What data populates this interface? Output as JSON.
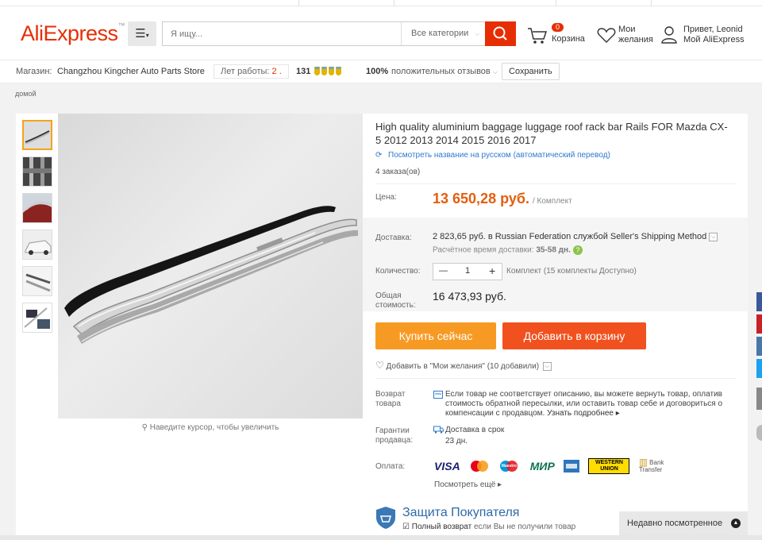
{
  "header": {
    "logo": "AliExpress",
    "search_placeholder": "Я ищу...",
    "category": "Все категории",
    "cart_count": "0",
    "cart_label": "Корзина",
    "wish_label": "Мои желания",
    "greeting": "Привет, Leonid",
    "account_label": "Мой AliExpress"
  },
  "store": {
    "label": "Магазин:",
    "name": "Changzhou Kingcher Auto Parts Store",
    "years_label": "Лет работы:",
    "years_value": "2",
    "rating": "131",
    "feedback_pct": "100%",
    "feedback_label": "положительных отзывов",
    "save_label": "Сохранить"
  },
  "breadcrumb": "домой",
  "gallery": {
    "zoom_hint": "Наведите курсор, чтобы увеличить",
    "thumb_count": 6
  },
  "product": {
    "title": "High quality aluminium baggage luggage roof rack bar Rails FOR Mazda CX-5 2012 2013 2014 2015 2016 2017",
    "translate_link": "Посмотреть название на русском (автоматический перевод)",
    "orders": "4 заказа(ов)",
    "price_label": "Цена:",
    "price": "13 650,28 руб.",
    "price_unit": "/ Комплект",
    "shipping_label": "Доставка:",
    "shipping_text": "2 823,65 руб. в Russian Federation службой Seller's Shipping Method",
    "delivery_est_label": "Расчётное время доставки:",
    "delivery_est_value": "35-58 дн.",
    "qty_label": "Количество:",
    "qty_value": "1",
    "qty_available": "Комплект (15 комплекты Доступно)",
    "total_label_1": "Общая",
    "total_label_2": "стоимость:",
    "total_value": "16 473,93 руб.",
    "buy_now": "Купить сейчас",
    "add_to_cart": "Добавить в корзину",
    "wishlist_text": "Добавить в \"Мои желания\" (10 добавили)",
    "return_label_1": "Возврат",
    "return_label_2": "товара",
    "return_text": "Если товар не соответствует описанию, вы можете вернуть товар, оплатив стоимость обратной пересылки, или оставить товар себе и договориться о компенсации с продавцом.",
    "return_link": "Узнать подробнее",
    "guarantee_label_1": "Гарантии",
    "guarantee_label_2": "продавца:",
    "guarantee_1": "Доставка в срок",
    "guarantee_2": "23 дн.",
    "payment_label": "Оплата:",
    "payment_methods": [
      "VISA",
      "Maestro",
      "МИР",
      "WESTERN UNION",
      "Bank Transfer"
    ],
    "more_payment": "Посмотреть ещё",
    "protection_title": "Защита Покупателя",
    "protection_item": "Полный возврат",
    "protection_item_note": "если Вы не получили товар"
  },
  "recently_viewed": "Недавно посмотренное",
  "colors": {
    "brand": "#e62e04",
    "price": "#e35e0e",
    "buy": "#f79a23",
    "cart": "#f0511e",
    "link": "#2f7acc"
  }
}
